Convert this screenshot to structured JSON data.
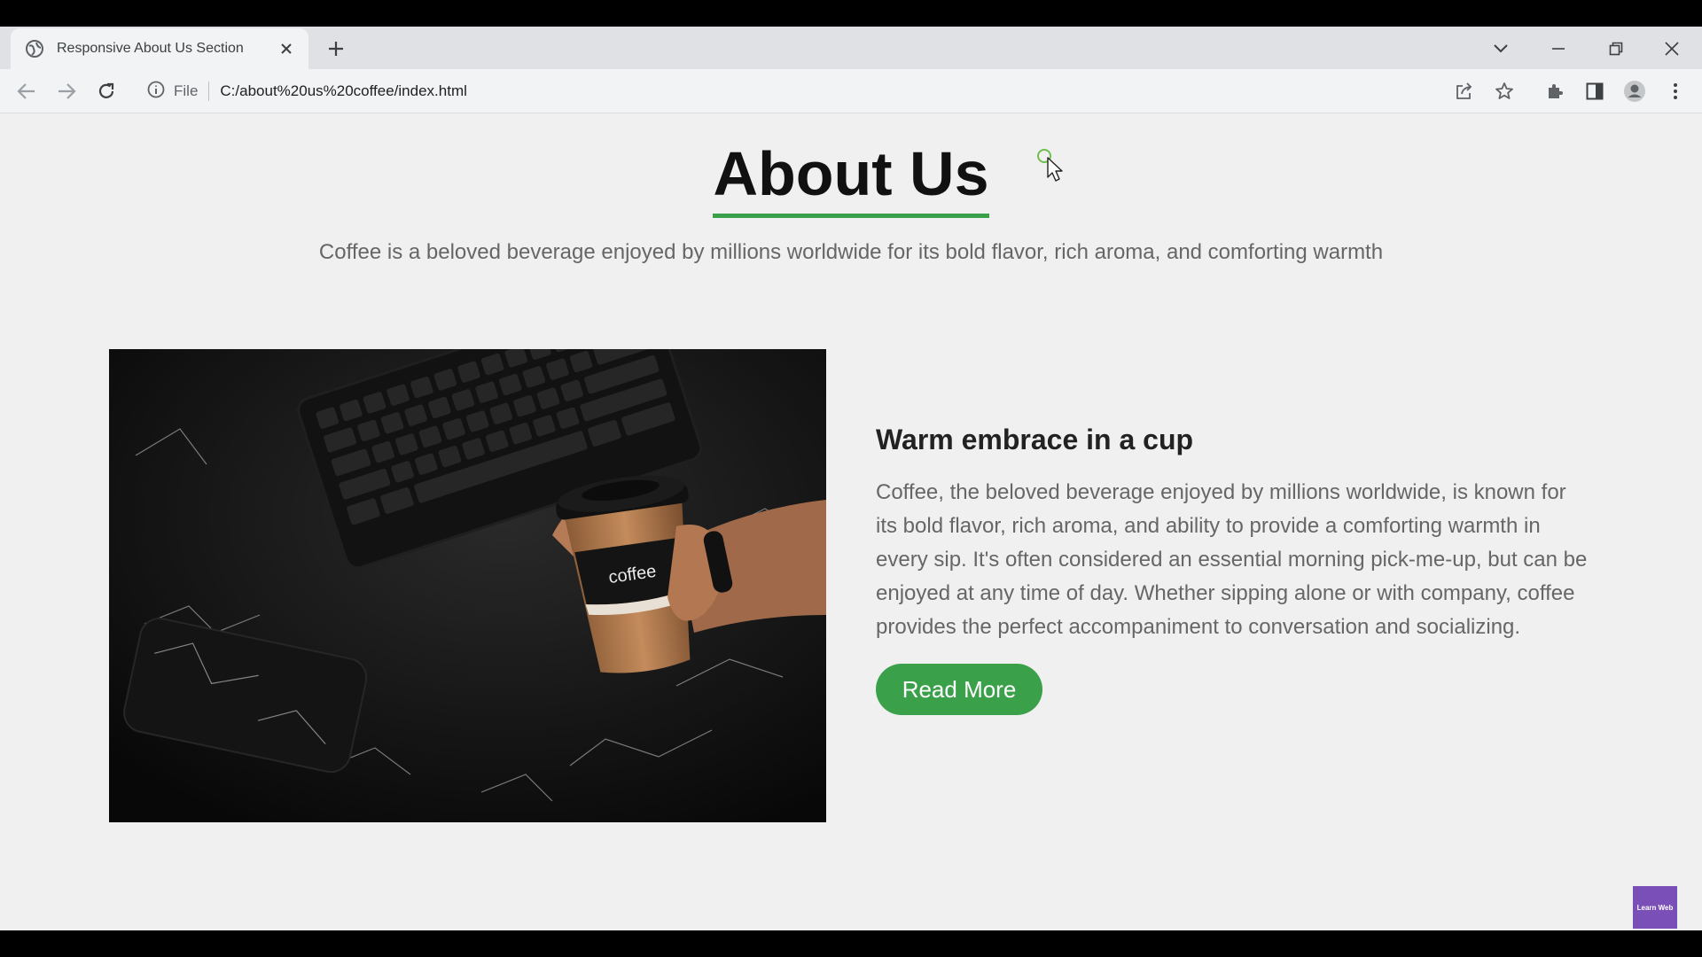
{
  "browser": {
    "tab_title": "Responsive About Us Section",
    "file_label": "File",
    "url": "C:/about%20us%20coffee/index.html"
  },
  "page": {
    "title": "About Us",
    "subtitle": "Coffee is a beloved beverage enjoyed by millions worldwide for its bold flavor, rich aroma, and comforting warmth",
    "image_label": "coffee",
    "content_heading": "Warm embrace in a cup",
    "content_body": "Coffee, the beloved beverage enjoyed by millions worldwide, is known for its bold flavor, rich aroma, and ability to provide a comforting warmth in every sip. It's often considered an essential morning pick-me-up, but can be enjoyed at any time of day. Whether sipping alone or with company, coffee provides the perfect accompaniment to conversation and socializing.",
    "button_label": "Read More",
    "watermark": "Learn Web"
  },
  "colors": {
    "accent": "#3aa14a",
    "page_background": "#f0f0f0",
    "watermark": "#7b4fb8"
  }
}
